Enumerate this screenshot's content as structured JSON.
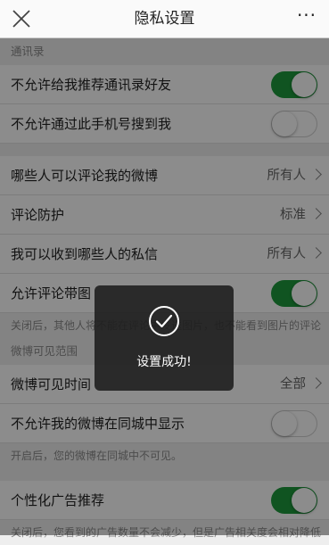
{
  "header": {
    "title": "隐私设置",
    "close_icon": "close-icon",
    "more_label": "···"
  },
  "sections": {
    "contacts_header": "通讯录",
    "weibo_visible_header": "微博可见范围"
  },
  "rows": {
    "no_recommend_contacts": {
      "label": "不允许给我推荐通讯录好友",
      "on": true
    },
    "no_search_by_phone": {
      "label": "不允许通过此手机号搜到我",
      "on": false
    },
    "who_can_comment": {
      "label": "哪些人可以评论我的微博",
      "value": "所有人"
    },
    "comment_protection": {
      "label": "评论防护",
      "value": "标准"
    },
    "who_can_message": {
      "label": "我可以收到哪些人的私信",
      "value": "所有人"
    },
    "allow_comment_with_image": {
      "label": "允许评论带图",
      "on": true
    },
    "weibo_visible_time": {
      "label": "微博可见时间",
      "value": "全部"
    },
    "no_show_in_city": {
      "label": "不允许我的微博在同城中显示",
      "on": false
    },
    "personalized_ads": {
      "label": "个性化广告推荐",
      "on": true
    }
  },
  "notes": {
    "comment_image_note": "关闭后，其他人将不能在评论中发送图片，也不能看到图片的评论",
    "city_note": "开启后，您的微博在同城中不可见。",
    "ads_note": "关闭后，您看到的广告数量不会减少，但是广告相关度会相对降低"
  },
  "toast": {
    "icon": "check-circle-icon",
    "message": "设置成功!"
  },
  "colors": {
    "toggle_on": "#1e9a3c",
    "toggle_off": "#ffffff",
    "overlay": "rgba(0,0,0,0.45)"
  }
}
